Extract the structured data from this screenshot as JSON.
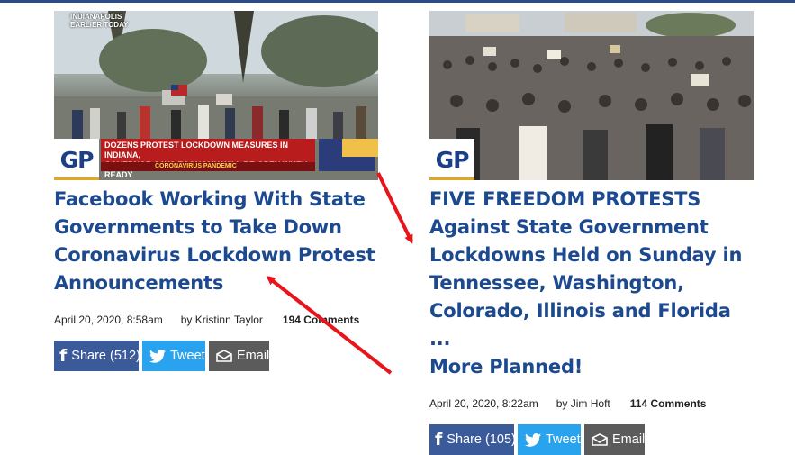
{
  "articles": [
    {
      "thumbnail": {
        "badge": "GP",
        "channel_tag_line1": "INDIANAPOLIS",
        "channel_tag_line2": "EARLIER TODAY",
        "banner_line1": "DOZENS PROTEST LOCKDOWN MEASURES IN INDIANA,",
        "banner_line2": "GOVERNOR SAYS ECONOMY WILL RE-OPEN WHEN READY",
        "banner_lower": "CORONAVIRUS PANDEMIC"
      },
      "title": "Facebook Working With State Governments to Take Down Coronavirus Lockdown Protest Announcements",
      "title_lines": [
        "Facebook Working With State",
        "Governments to Take Down",
        "Coronavirus Lockdown Protest",
        "Announcements"
      ],
      "date": "April 20, 2020, 8:58am",
      "author": "by Kristinn Taylor",
      "comments": "194 Comments",
      "share": {
        "facebook_label": "Share",
        "facebook_count": "(512)",
        "tweet_label": "Tweet",
        "email_label": "Email"
      }
    },
    {
      "thumbnail": {
        "badge": "GP"
      },
      "title_lines": [
        "FIVE FREEDOM PROTESTS",
        "Against State Government",
        "Lockdowns Held on Sunday in",
        "Tennessee, Washington,",
        "Colorado, Illinois and Florida ...",
        "More Planned!"
      ],
      "date": "April 20, 2020, 8:22am",
      "author": "by Jim Hoft",
      "comments": "114 Comments",
      "share": {
        "facebook_label": "Share",
        "facebook_count": "(105)",
        "tweet_label": "Tweet",
        "email_label": "Email"
      }
    }
  ],
  "colors": {
    "headline": "#1d4a8f",
    "facebook": "#3b5a9a",
    "twitter": "#2aa3ef",
    "email": "#5b5b5b",
    "annotation_arrow": "#e8141a"
  }
}
